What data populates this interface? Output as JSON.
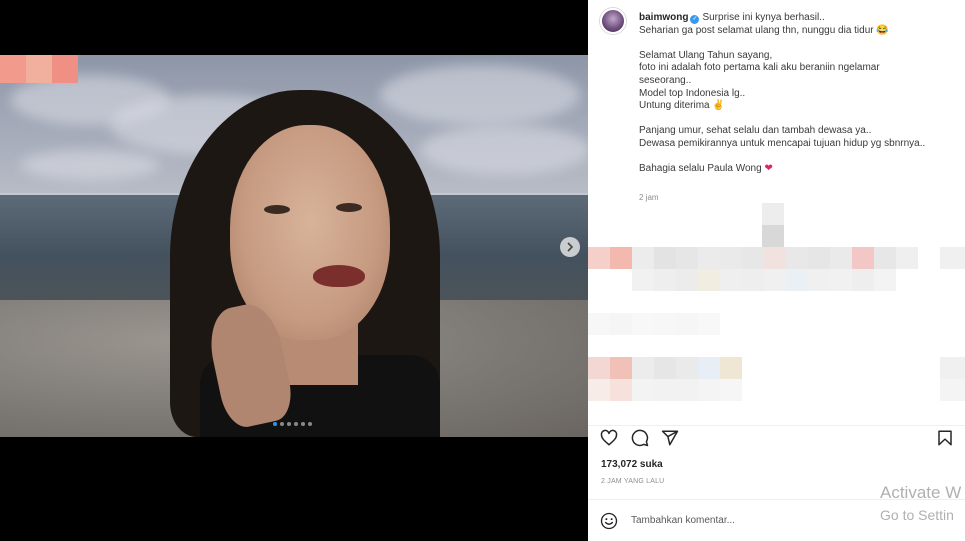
{
  "post": {
    "username": "baimwong",
    "caption_lines": [
      "Surprise ini kynya berhasil..",
      "Seharian ga post selamat ulang thn, nunggu dia tidur 😂",
      "",
      "Selamat Ulang Tahun sayang,",
      "foto ini adalah foto pertama kali aku beraniin ngelamar",
      "seseorang..",
      "Model top Indonesia lg..",
      "Untung diterima ✌️",
      "",
      "Panjang umur, sehat selalu dan tambah dewasa ya..",
      "Dewasa pemikirannya untuk mencapai tujuan hidup yg sbnrnya..",
      "",
      "Bahagia selalu Paula Wong ❤️"
    ],
    "caption_time": "2 jam",
    "likes": "173,072 suka",
    "post_time": "2 JAM YANG LALU",
    "carousel_count": 6,
    "carousel_active": 1
  },
  "comment_box": {
    "placeholder": "Tambahkan komentar..."
  },
  "icons": {
    "like": "heart-icon",
    "comment": "comment-icon",
    "share": "share-icon",
    "save": "bookmark-icon",
    "emoji": "emoji-icon",
    "next": "chevron-right-icon",
    "verified": "verified-badge-icon"
  },
  "colors": {
    "verified": "#3897f0",
    "active_dot": "#2a93f5",
    "heart_emoji": "#e0245e"
  },
  "watermark": {
    "line1": "Activate W",
    "line2": "Go to Settin"
  }
}
